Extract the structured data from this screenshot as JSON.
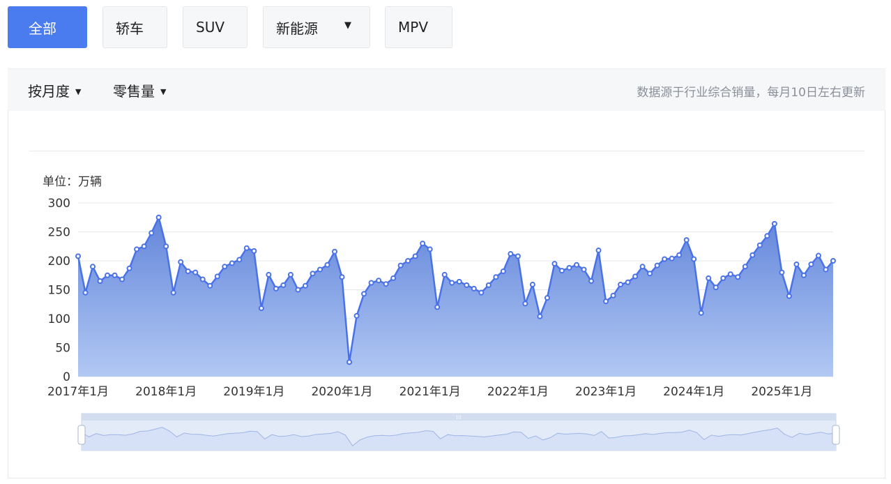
{
  "tabs": [
    {
      "label": "全部",
      "active": true
    },
    {
      "label": "轿车",
      "active": false
    },
    {
      "label": "SUV",
      "active": false
    },
    {
      "label": "新能源",
      "active": false
    },
    {
      "label": "MPV",
      "active": false
    }
  ],
  "toolbar": {
    "period_label": "按月度",
    "metric_label": "零售量",
    "source_note": "数据源于行业综合销量，每月10日左右更新"
  },
  "colors": {
    "accent": "#4a7cf0",
    "line": "#4a72e8",
    "area_top": "#5a7fd8",
    "area_bottom": "#a9c2f2"
  },
  "chart_data": {
    "type": "area",
    "unit_label": "单位：万辆",
    "ylim": [
      0,
      300
    ],
    "yticks": [
      0,
      50,
      100,
      150,
      200,
      250,
      300
    ],
    "grid": true,
    "x_tick_labels": [
      "2017年1月",
      "2018年1月",
      "2019年1月",
      "2020年1月",
      "2021年1月",
      "2022年1月",
      "2023年1月",
      "2024年1月",
      "2025年1月"
    ],
    "x_start": "2017-01",
    "x_end": "2025-06",
    "values": [
      208,
      145,
      190,
      165,
      175,
      175,
      168,
      187,
      220,
      225,
      248,
      275,
      225,
      145,
      198,
      182,
      180,
      168,
      157,
      173,
      190,
      196,
      202,
      222,
      217,
      118,
      176,
      152,
      158,
      176,
      150,
      157,
      178,
      185,
      193,
      216,
      172,
      25,
      105,
      143,
      162,
      166,
      160,
      170,
      192,
      200,
      208,
      230,
      220,
      120,
      176,
      162,
      164,
      158,
      152,
      145,
      158,
      172,
      182,
      212,
      208,
      126,
      159,
      104,
      136,
      195,
      183,
      188,
      193,
      185,
      165,
      218,
      130,
      140,
      159,
      163,
      173,
      190,
      178,
      192,
      203,
      204,
      210,
      236,
      203,
      110,
      170,
      154,
      170,
      177,
      172,
      190,
      210,
      227,
      243,
      264,
      180,
      139,
      194,
      175,
      194,
      209,
      185,
      200
    ]
  }
}
